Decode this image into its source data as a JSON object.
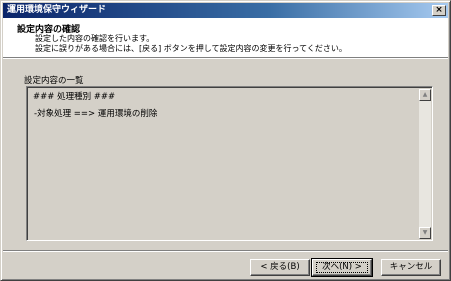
{
  "window": {
    "title": "運用環境保守ウィザード",
    "close_glyph": "×"
  },
  "header": {
    "title": "設定内容の確認",
    "line1": "設定した内容の確認を行います。",
    "line2": "設定に誤りがある場合には、[戻る] ボタンを押して設定内容の変更を行ってください。"
  },
  "list": {
    "label": "設定内容の一覧",
    "lines": [
      "### 処理種別 ###",
      "-対象処理 ==> 運用環境の削除"
    ]
  },
  "scrollbar": {
    "up_glyph": "▲",
    "down_glyph": "▼"
  },
  "buttons": {
    "back": "< 戻る(B)",
    "next": "次へ(N) >",
    "cancel": "キャンセル"
  }
}
